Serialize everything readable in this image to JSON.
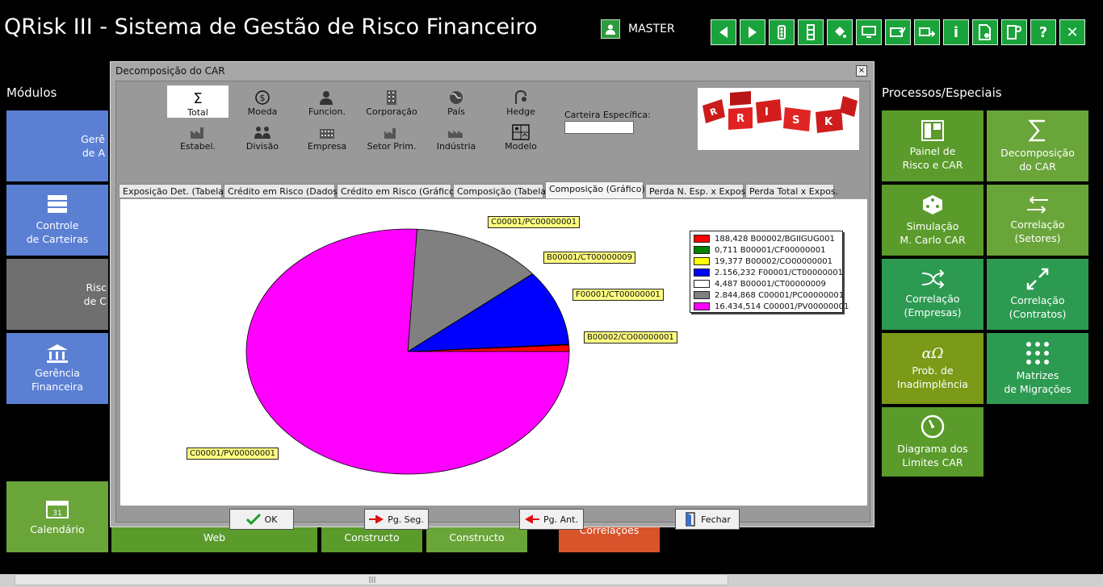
{
  "app": {
    "title": "QRisk III - Sistema de Gestão de Risco Financeiro",
    "user": "MASTER"
  },
  "toolbar": [
    "back-icon",
    "forward-icon",
    "traffic-icon",
    "traffic-vertical-icon",
    "paint-bucket-icon",
    "monitor-icon",
    "mail-check-icon",
    "mail-forward-icon",
    "info-icon",
    "document-settings-icon",
    "exit-report-icon",
    "help-icon",
    "close-icon"
  ],
  "toolbar_labels": {
    "info": "i",
    "help": "?",
    "close": "✕"
  },
  "left": {
    "title": "Módulos",
    "tiles": [
      {
        "label1": "Gerê",
        "label2": "de A"
      },
      {
        "label1": "Controle",
        "label2": "de Carteiras"
      },
      {
        "label1": "Risc",
        "label2": "de  C"
      },
      {
        "label1": "Gerência",
        "label2": "Financeira"
      },
      {
        "label1": "Calendário",
        "label2": ""
      }
    ]
  },
  "bottom_tiles": [
    "Web",
    "Constructo",
    "Constructo",
    "Correlações"
  ],
  "right": {
    "title": "Processos/Especiais",
    "tiles": [
      {
        "label1": "Painel de",
        "label2": "Risco e CAR"
      },
      {
        "label1": "Decomposição",
        "label2": "do CAR"
      },
      {
        "label1": "Simulação",
        "label2": "M. Carlo CAR"
      },
      {
        "label1": "Correlação",
        "label2": "(Setores)"
      },
      {
        "label1": "Correlação",
        "label2": "(Empresas)"
      },
      {
        "label1": "Correlação",
        "label2": "(Contratos)"
      },
      {
        "label1": "Prob. de",
        "label2": "Inadimplência",
        "icon": "αΩ"
      },
      {
        "label1": "Matrizes",
        "label2": "de Migrações"
      },
      {
        "label1": "Diagrama dos",
        "label2": "Limites CAR"
      }
    ]
  },
  "dialog": {
    "title": "Decomposição do CAR",
    "close": "×",
    "groups": [
      {
        "label": "Total",
        "icon": "Σ"
      },
      {
        "label": "Moeda",
        "icon": "$"
      },
      {
        "label": "Funcion.",
        "icon": ""
      },
      {
        "label": "Corporação",
        "icon": ""
      },
      {
        "label": "País",
        "icon": ""
      },
      {
        "label": "Hedge",
        "icon": ""
      },
      {
        "label": "Estabel.",
        "icon": ""
      },
      {
        "label": "Divisão",
        "icon": ""
      },
      {
        "label": "Empresa",
        "icon": ""
      },
      {
        "label": "Setor Prim.",
        "icon": ""
      },
      {
        "label": "Indústria",
        "icon": ""
      },
      {
        "label": "Modelo",
        "icon": ""
      }
    ],
    "carteira_label": "Carteira Específica:",
    "carteira_value": "",
    "logo_letters": [
      "R",
      "I",
      "S",
      "K"
    ],
    "tabs": [
      "Exposição Det. (Tabela)",
      "Crédito em Risco (Dados)",
      "Crédito em Risco (Gráfico)",
      "Composição (Tabela)",
      "Composição (Gráfico)",
      "Perda N. Esp. x Expos.",
      "Perda Total x Expos."
    ],
    "buttons": {
      "ok": "OK",
      "next": "Pg. Seg.",
      "prev": "Pg. Ant.",
      "close": "Fechar"
    }
  },
  "chart_data": {
    "type": "pie",
    "slices": [
      {
        "key": "B00002/BGIIGUG001",
        "value": 188.428,
        "legend": "188,428 B00002/BGIIGUG001",
        "color": "#ff0000"
      },
      {
        "key": "B00001/CF00000001",
        "value": 0.711,
        "legend": "0,711 B00001/CF00000001",
        "color": "#008000"
      },
      {
        "key": "B00002/CO00000001",
        "value": 19.377,
        "legend": "19,377 B00002/CO00000001",
        "color": "#ffff00"
      },
      {
        "key": "F00001/CT00000001",
        "value": 2156.232,
        "legend": "2.156,232 F00001/CT00000001",
        "color": "#0000ff"
      },
      {
        "key": "B00001/CT00000009",
        "value": 4.487,
        "legend": "4,487 B00001/CT00000009",
        "color": "#ffffff"
      },
      {
        "key": "C00001/PC00000001",
        "value": 2844.868,
        "legend": "2.844,868 C00001/PC00000001",
        "color": "#808080"
      },
      {
        "key": "C00001/PV00000001",
        "value": 16434.514,
        "legend": "16.434,514 C00001/PV00000001",
        "color": "#ff00ff"
      }
    ],
    "point_labels": [
      "C00001/PC00000001",
      "B00001/CT00000009",
      "F00001/CT00000001",
      "B00002/CO00000001",
      "C00001/PV00000001"
    ],
    "legend_position": "top-right"
  }
}
